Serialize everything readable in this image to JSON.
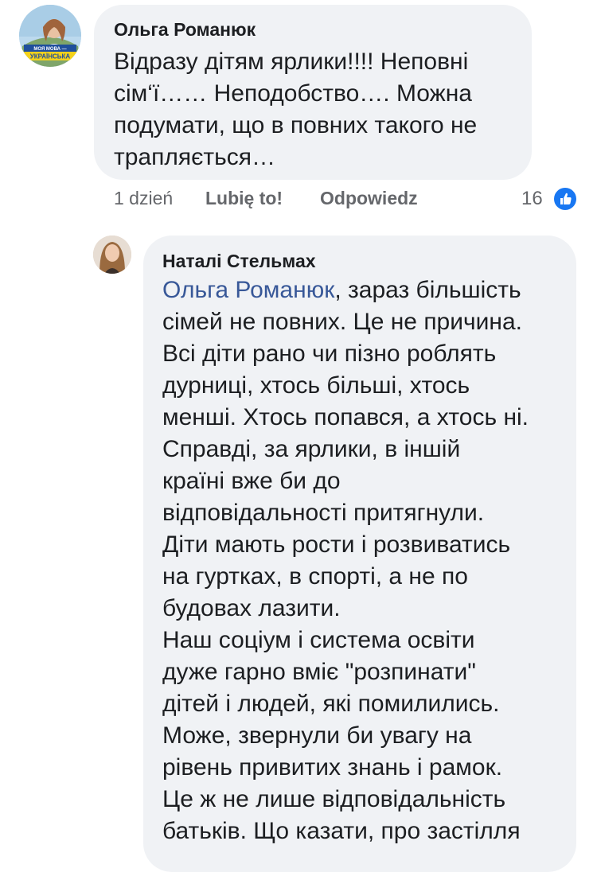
{
  "comment1": {
    "avatar_text_top": "МОЯ МОВА —",
    "avatar_text_bottom": "УКРАЇНСЬКА",
    "author": "Ольга Романюк",
    "lines": [
      "Відразу дітям ярлики!!!! Неповні",
      "сім‘ї……  Неподобство…. Можна",
      "подумати, що в повних такого не",
      "трапляється…"
    ],
    "time": "1 dzień",
    "like_label": "Lubię to!",
    "reply_label": "Odpowiedz",
    "reaction_count": "16",
    "reaction_icon": "thumbs-up-icon",
    "accent_color": "#1877f2"
  },
  "comment2": {
    "author": "Наталі Стельмах",
    "mention": "Ольга Романюк",
    "first_line_rest": ", зараз більшість",
    "lines": [
      "сімей не повних. Це не причина.",
      "Всі діти рано чи пізно роблять",
      "дурниці, хтось більші, хтось",
      "менші. Хтось попався, а хтось ні.",
      "Справді, за ярлики, в іншій",
      "країні вже би до",
      "відповідальності притягнули.",
      "Діти мають рости і розвиватись",
      "на гуртках, в спорті, а не по",
      "будовах лазити.",
      "Наш соціум і система освіти",
      "дуже гарно вміє \"розпинати\"",
      "дітей і людей,  які помилились.",
      "Може, звернули би увагу на",
      "рівень привитих знань і рамок.",
      "Це ж не лише відповідальність",
      "батьків. Що казати, про застілля"
    ],
    "mention_color": "#385898"
  }
}
